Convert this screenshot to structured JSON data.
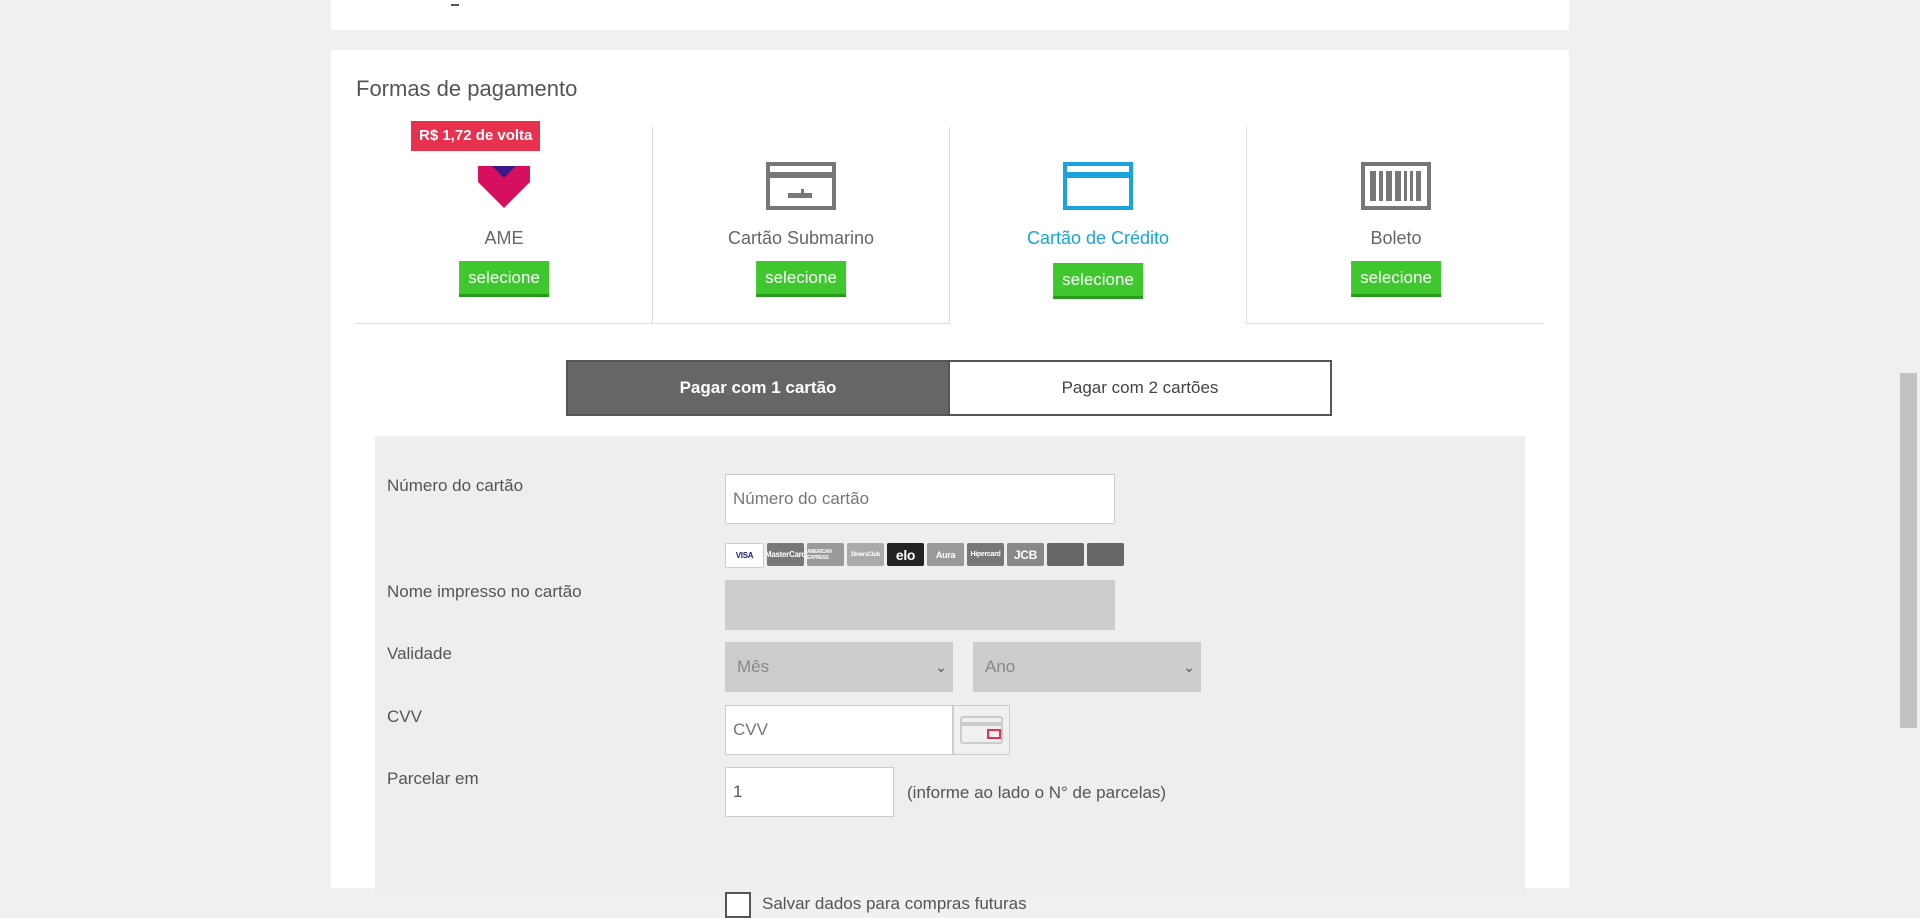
{
  "section_title": "Formas de pagamento",
  "methods": [
    {
      "name": "AME",
      "button": "selecione",
      "badge": "R$ 1,72 de volta",
      "icon": "ame-heart-icon"
    },
    {
      "name": "Cartão Submarino",
      "button": "selecione",
      "icon": "submarino-card-icon"
    },
    {
      "name": "Cartão de Crédito",
      "button": "selecione",
      "icon": "credit-card-icon",
      "active": true
    },
    {
      "name": "Boleto",
      "button": "selecione",
      "icon": "barcode-icon"
    }
  ],
  "split": {
    "one_card": "Pagar com 1 cartão",
    "two_cards": "Pagar com 2 cartões"
  },
  "form": {
    "card_number_label": "Número do cartão",
    "card_number_placeholder": "Número do cartão",
    "name_label": "Nome impresso no cartão",
    "validity_label": "Validade",
    "month_placeholder": "Mês",
    "year_placeholder": "Ano",
    "cvv_label": "CVV",
    "cvv_placeholder": "CVV",
    "installments_label": "Parcelar em",
    "installments_value": "1",
    "installments_hint": "(informe ao lado o N° de parcelas)",
    "save_label": "Salvar dados para compras futuras"
  },
  "brands": [
    {
      "name": "VISA",
      "color": "#1a1f71"
    },
    {
      "name": "MasterCard",
      "color": "#777777"
    },
    {
      "name": "AMERICAN EXPRESS",
      "color": "#999999"
    },
    {
      "name": "DinersClub",
      "color": "#aaaaaa"
    },
    {
      "name": "elo",
      "color": "#222222"
    },
    {
      "name": "Aura",
      "color": "#999999"
    },
    {
      "name": "Hipercard",
      "color": "#777777"
    },
    {
      "name": "JCB",
      "color": "#888888"
    },
    {
      "name": "card",
      "color": "#666666"
    },
    {
      "name": "card",
      "color": "#666666"
    }
  ],
  "colors": {
    "accent": "#1aa3dc",
    "button": "#3ec82e",
    "badge": "#e8304f"
  }
}
